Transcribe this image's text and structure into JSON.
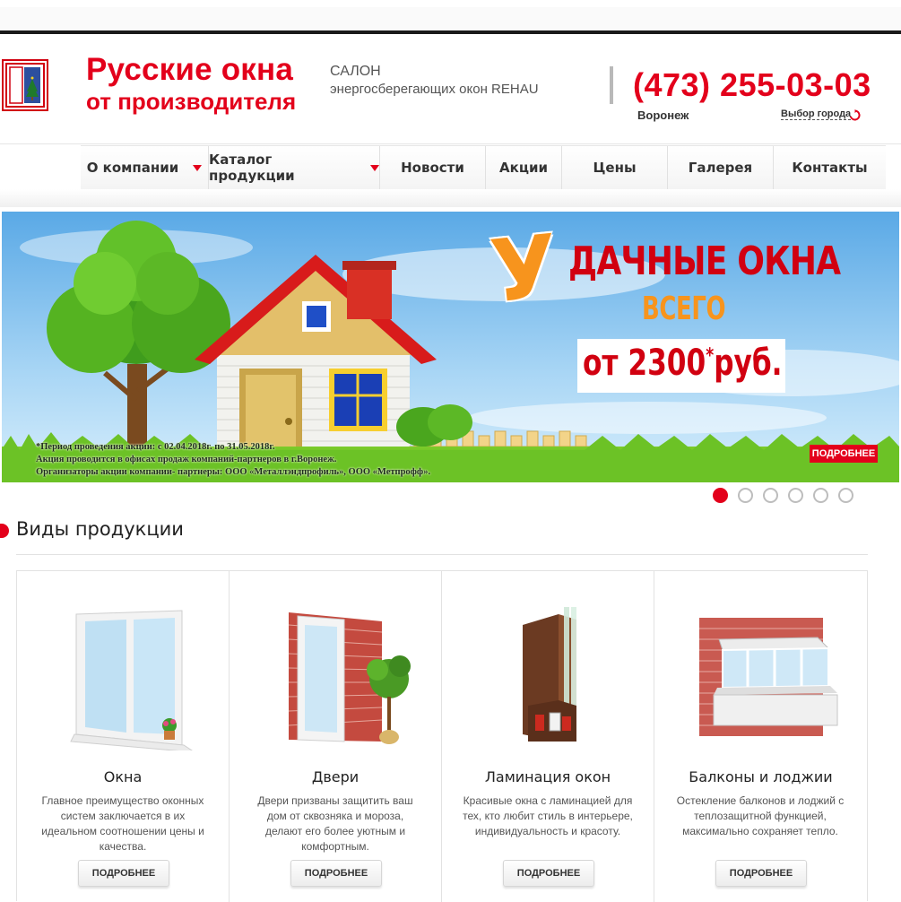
{
  "colors": {
    "brand": "#e3001b",
    "promo_orange": "#f7941d"
  },
  "header": {
    "logo_icon": "window-logo-icon",
    "brand_line1": "Русские окна",
    "brand_line2": "от производителя",
    "salon_line1": "САЛОН",
    "salon_line2": "энергосберегающих окон REHAU",
    "phone": "(473) 255-03-03",
    "city": "Воронеж",
    "city_select_label": "Выбор города",
    "city_select_icon": "refresh-icon"
  },
  "nav": {
    "items": [
      {
        "label": "О компании",
        "has_dropdown": true
      },
      {
        "label": "Каталог продукции",
        "has_dropdown": true
      },
      {
        "label": "Новости",
        "has_dropdown": false
      },
      {
        "label": "Акции",
        "has_dropdown": false
      },
      {
        "label": "Цены",
        "has_dropdown": false
      },
      {
        "label": "Галерея",
        "has_dropdown": false
      },
      {
        "label": "Контакты",
        "has_dropdown": false
      }
    ]
  },
  "banner": {
    "promo_first_letter": "У",
    "promo_rest": "ДАЧНЫЕ ОКНА",
    "promo_line2": "ВСЕГО",
    "price_prefix": "от 2300",
    "price_asterisk": "*",
    "price_suffix": "руб.",
    "note_line1": "*Период проведения акции: с 02.04.2018г. по 31.05.2018г.",
    "note_line2": "Акция проводится в офисах продаж компаний-партнеров в г.Воронеж.",
    "note_line3": "Организаторы акции компании- партнеры: ООО «Металлэндпрофиль», ООО «Метпрофф».",
    "more_label": "ПОДРОБНЕЕ"
  },
  "slider": {
    "total": 6,
    "active": 1
  },
  "section": {
    "title": "Виды продукции"
  },
  "products": [
    {
      "title": "Окна",
      "description": "Главное преимущество оконных систем заключается в их идеальном соотношении цены и качества.",
      "button": "ПОДРОБНЕЕ",
      "icon": "window-product-icon"
    },
    {
      "title": "Двери",
      "description": "Двери призваны защитить ваш дом от сквозняка и мороза, делают его более уютным и комфортным.",
      "button": "ПОДРОБНЕЕ",
      "icon": "door-product-icon"
    },
    {
      "title": "Ламинация окон",
      "description": "Красивые окна с ламинацией для тех, кто любит стиль в интерьере, индивидуальность и красоту.",
      "button": "ПОДРОБНЕЕ",
      "icon": "lamination-product-icon"
    },
    {
      "title": "Балконы и лоджии",
      "description": "Остекление балконов и лоджий с теплозащитной функцией, максимально сохраняет тепло.",
      "button": "ПОДРОБНЕЕ",
      "icon": "balcony-product-icon"
    }
  ]
}
